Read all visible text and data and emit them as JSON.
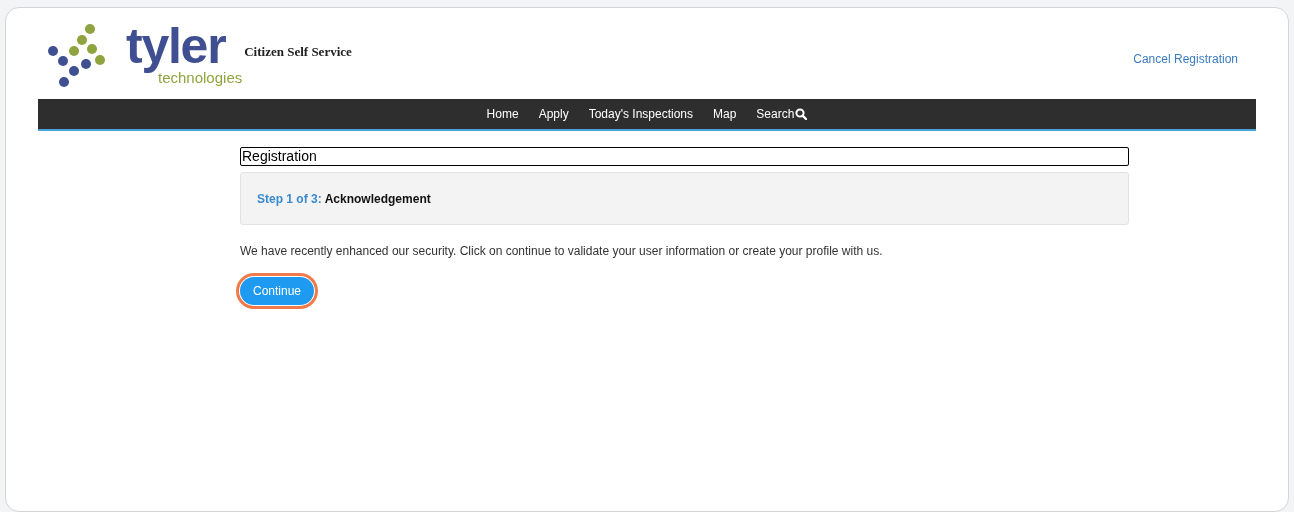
{
  "logo": {
    "wordmark": "tyler",
    "tagline": "technologies"
  },
  "site_title": "Citizen Self Service",
  "header_link": "Cancel Registration",
  "nav": [
    {
      "label": "Home",
      "icon": false
    },
    {
      "label": "Apply",
      "icon": false
    },
    {
      "label": "Today's Inspections",
      "icon": false
    },
    {
      "label": "Map",
      "icon": false
    },
    {
      "label": "Search",
      "icon": true
    }
  ],
  "heading": "Registration",
  "step": {
    "label": "Step 1 of 3:",
    "name": "Acknowledgement"
  },
  "message": "We have recently enhanced our security. Click on continue to validate your user information or create your profile with us.",
  "button": {
    "label": "Continue",
    "highlighted": true
  }
}
